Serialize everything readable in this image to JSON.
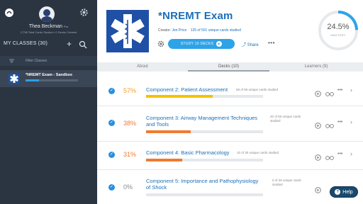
{
  "sidebar": {
    "user_name": "Thea Beckman",
    "user_badge": "Pro",
    "user_stats": "2,798 Total Cards Studied • 0 Decks Created",
    "classes_label": "MY CLASSES (30)",
    "add_label": "+",
    "filter_placeholder": "Filter Classes",
    "active_class": {
      "name": "*NREMT Exam - Sandbox",
      "progress": 0.25
    }
  },
  "header": {
    "title": "*NREMT Exam",
    "creator_prefix": "Creator:",
    "creator_name": "Jeri Price",
    "cards_studied": "125 of 501 unique cards studied",
    "study_button": "STUDY 10 DECKS",
    "share_label": "Share",
    "more_label": "•••",
    "mastery_value": "24.5%",
    "mastery_label": "MASTERY",
    "mastery_fraction": 0.245
  },
  "tabs": [
    {
      "label": "About"
    },
    {
      "label": "Decks (10)"
    },
    {
      "label": "Learners (9)"
    }
  ],
  "decks": [
    {
      "percent": "57%",
      "name_line1": "Component 2: Patient Assessment",
      "name_line2": "",
      "studied_line1": "58 of 65 unique cards studied",
      "studied_line2": "",
      "progress": 0.57,
      "color": "#f2c300",
      "pct_color": "#f0a030"
    },
    {
      "percent": "38%",
      "name_line1": "Component 3: Airway Management Techniques",
      "name_line2": "and Tools",
      "studied_line1": "20 of 50 unique cards",
      "studied_line2": "studied",
      "progress": 0.38,
      "color": "#f07a30",
      "pct_color": "#f07a30"
    },
    {
      "percent": "31%",
      "name_line1": "Component 4: Basic Pharmacology",
      "name_line2": "",
      "studied_line1": "10 of 30 unique cards studied",
      "studied_line2": "",
      "progress": 0.31,
      "color": "#f07a30",
      "pct_color": "#f07a30"
    },
    {
      "percent": "0%",
      "name_line1": "Component 5: Importance and Pathophysiology",
      "name_line2": "of Shock",
      "studied_line1": "0 of 25 unique cards",
      "studied_line2": "studied",
      "progress": 0.0,
      "color": "#e4e7eb",
      "pct_color": "#888888"
    }
  ],
  "help_label": "Help"
}
